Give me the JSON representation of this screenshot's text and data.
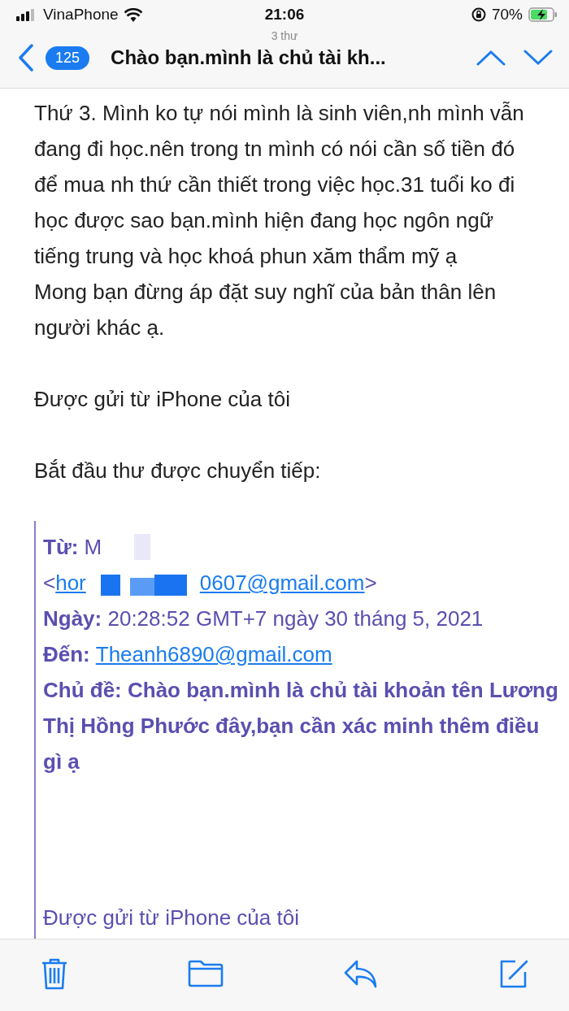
{
  "status_bar": {
    "carrier": "VinaPhone",
    "time": "21:06",
    "battery": "70%"
  },
  "nav": {
    "subtitle": "3 thư",
    "badge": "125",
    "title": "Chào bạn.mình là chủ tài kh..."
  },
  "body": {
    "groups": [
      [
        "Thứ 3. Mình ko tự nói mình là sinh viên,nh mình vẫn đang đi học.nên trong tn mình có nói cần số tiền đó để mua nh thứ cần thiết trong việc học.31 tuổi ko đi học được sao bạn.mình hiện đang học ngôn ngữ tiếng trung và học khoá phun xăm thẩm mỹ ạ",
        "Mong bạn đừng áp đặt suy nghĩ của bản thân lên người khác ạ."
      ],
      [
        "Được gửi từ iPhone của tôi"
      ],
      [
        "Bắt đầu thư được chuyển tiếp:"
      ]
    ]
  },
  "forwarded": {
    "from": {
      "label": "Từ:",
      "value": "M"
    },
    "address": {
      "start": "<",
      "link_start": "hor",
      "link_end": "0607@gmail.com",
      "end": ">"
    },
    "date": {
      "label": "Ngày:",
      "value": "20:28:52 GMT+7 ngày 30 tháng 5, 2021"
    },
    "to": {
      "label": "Đến:",
      "value": "Theanh6890@gmail.com"
    },
    "subject": {
      "label": "Chủ đề:",
      "value": "Chào bạn.mình là chủ tài khoản tên Lương Thị Hồng Phước đây,bạn cần xác minh thêm điều gì ạ"
    },
    "signature": "Được gửi từ iPhone của tôi"
  }
}
